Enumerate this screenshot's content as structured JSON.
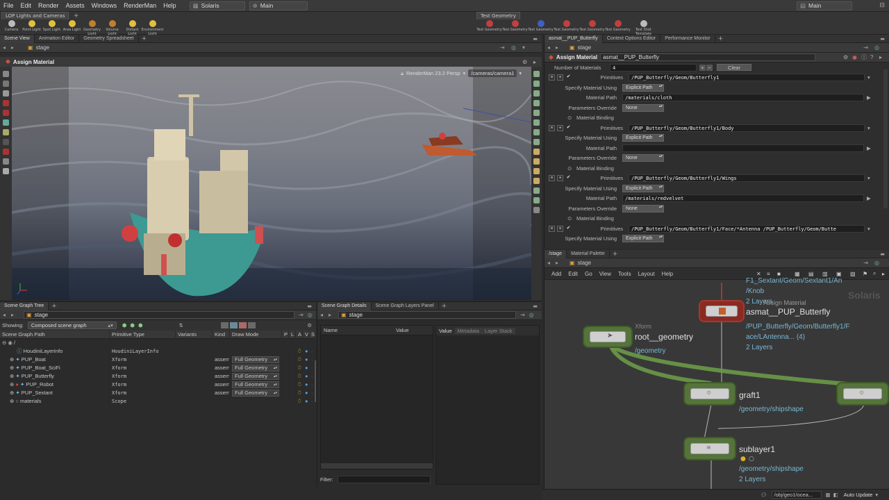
{
  "menubar": {
    "items": [
      "File",
      "Edit",
      "Render",
      "Assets",
      "Windows",
      "RenderMan",
      "Help"
    ],
    "desktop": "Solaris",
    "context": "Main",
    "right_context": "Main"
  },
  "shelf": {
    "left_tab": "LOP Lights and Cameras",
    "left_tools": [
      "Camera",
      "Point Light",
      "Spot Light",
      "Area Light",
      "Geometry Light",
      "Volume Light",
      "Distant Light",
      "Environment Light"
    ],
    "right_tab": "Test Geometry",
    "right_tools": [
      "Test Geometry",
      "Test Geometry",
      "Test Geometry",
      "Test Geometry",
      "Test Geometry",
      "Test Geometry",
      "Test Shot Template"
    ]
  },
  "left_panel": {
    "tabs": [
      "Scene View",
      "Animation Editor",
      "Geometry Spreadsheet"
    ],
    "path": "stage",
    "title": "Assign Material",
    "viewport_label": "RenderMan 23.2 Persp",
    "camera": "/cameras/camera1"
  },
  "scene_graph": {
    "tabs": [
      "Scene Graph Tree"
    ],
    "path": "stage",
    "showing_label": "Showing:",
    "showing_value": "Composed scene graph",
    "columns": [
      "Scene Graph Path",
      "Primitive Type",
      "Variants",
      "Kind",
      "Draw Mode",
      "P",
      "L",
      "A",
      "V",
      "S"
    ],
    "root": "/",
    "rows": [
      {
        "name": "HoudiniLayerInfo",
        "type": "HoudiniLayerInfo",
        "kind": "",
        "draw": ""
      },
      {
        "name": "PUP_Boat",
        "type": "Xform",
        "kind": "assem",
        "draw": "Full Geometry"
      },
      {
        "name": "PUP_Boat_SciFi",
        "type": "Xform",
        "kind": "assem",
        "draw": "Full Geometry"
      },
      {
        "name": "PUP_Butterfly",
        "type": "Xform",
        "kind": "assem",
        "draw": "Full Geometry"
      },
      {
        "name": "PUP_Robot",
        "type": "Xform",
        "kind": "assem",
        "draw": "Full Geometry"
      },
      {
        "name": "PUP_Sextant",
        "type": "Xform",
        "kind": "assem",
        "draw": "Full Geometry"
      },
      {
        "name": "materials",
        "type": "Scope",
        "kind": "",
        "draw": ""
      }
    ]
  },
  "details": {
    "tabs": [
      "Scene Graph Details",
      "Scene Graph Layers Panel"
    ],
    "path": "stage",
    "col_name": "Name",
    "col_value": "Value",
    "right_tabs": [
      "Value",
      "Metadata",
      "Layer Stack"
    ],
    "filter_label": "Filter:"
  },
  "params": {
    "tabs": [
      "asmat__PUP_Butterfly",
      "Context Options Editor",
      "Performance Monitor"
    ],
    "path": "stage",
    "node_type": "Assign Material",
    "node_name": "asmat__PUP_Butterfly",
    "num_materials_label": "Number of Materials",
    "num_materials": "4",
    "clear_label": "Clear",
    "labels": {
      "primitives": "Primitives",
      "specify": "Specify Material Using",
      "path": "Material Path",
      "override": "Parameters Override",
      "binding": "Material Binding"
    },
    "blocks": [
      {
        "prims": "/PUP_Butterfly/Geom/Butterfly1",
        "using": "Explicit Path",
        "mat": "/materials/cloth",
        "override": "None"
      },
      {
        "prims": "/PUP_Butterfly/Geom/Butterfly1/Body",
        "using": "Explicit Path",
        "mat": "",
        "override": "None"
      },
      {
        "prims": "/PUP_Butterfly/Geom/Butterfly1/Wings",
        "using": "Explicit Path",
        "mat": "/materials/redvelvet",
        "override": "None"
      },
      {
        "prims": "/PUP_Butterfly/Geom/Butterfly1/Face/*Antenna /PUP_Butterfly/Geom/Butte",
        "using": "Explicit Path",
        "mat": "",
        "override": ""
      }
    ]
  },
  "network": {
    "tabs": [
      "/stage",
      "Material Palette"
    ],
    "path": "stage",
    "menu": [
      "Add",
      "Edit",
      "Go",
      "View",
      "Tools",
      "Layout",
      "Help"
    ],
    "watermark": "Solaris",
    "nodes": {
      "asmat": {
        "name": "asmat__PUP_Butterfly",
        "type_ghost": "Assign Material",
        "sub": [
          "/PUP_Butterfly/Geom/Butterfly1/F",
          "ace/LAntenna... (4)",
          "2 Layers"
        ],
        "top": [
          "F1_Sextant/Geom/Sextant1/An",
          "/Knob",
          "2 Layers"
        ]
      },
      "root": {
        "name": "root__geometry",
        "type": "Xform",
        "sub": "/geometry"
      },
      "graft": {
        "name": "graft1",
        "sub": "/geometry/shipshape"
      },
      "sublayer": {
        "name": "sublayer1",
        "sub": [
          "/geometry/shipshape",
          "2 Layers"
        ]
      }
    }
  },
  "statusbar": {
    "path": "/obj/geo1/ocea...",
    "auto_update": "Auto Update"
  },
  "colors": {
    "node_green": "#55733a",
    "node_red": "#a03a30",
    "path_blue": "#79b8d6"
  }
}
